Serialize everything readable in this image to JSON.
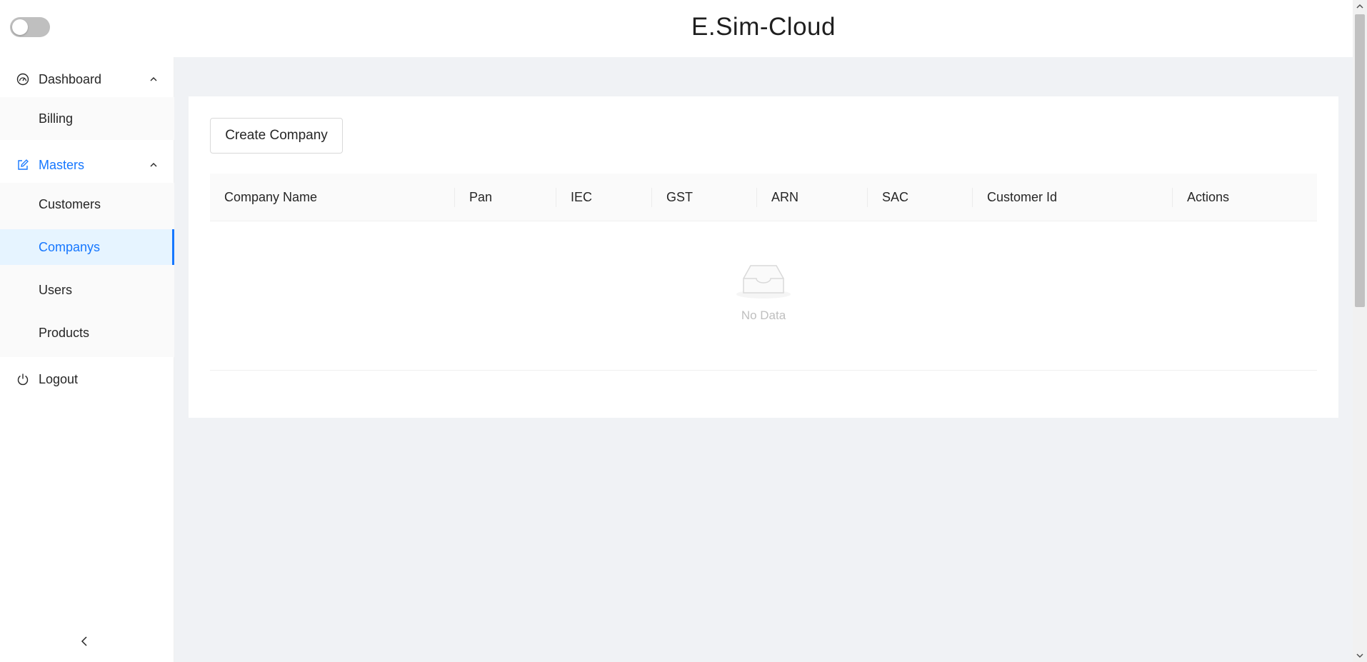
{
  "app": {
    "title": "E.Sim-Cloud",
    "theme_toggle": "off"
  },
  "colors": {
    "accent": "#1677ff",
    "active_bg": "#e6f4ff",
    "content_bg": "#f0f2f5"
  },
  "sidebar": {
    "items": [
      {
        "label": "Dashboard",
        "icon": "dashboard-icon",
        "expanded": true
      },
      {
        "label": "Billing",
        "sub": true
      },
      {
        "label": "Masters",
        "icon": "edit-icon",
        "expanded": true
      },
      {
        "label": "Customers",
        "sub": true
      },
      {
        "label": "Companys",
        "sub": true,
        "active": true
      },
      {
        "label": "Users",
        "sub": true
      },
      {
        "label": "Products",
        "sub": true
      },
      {
        "label": "Logout",
        "icon": "power-icon"
      }
    ],
    "collapse_icon": "chevron-left-icon"
  },
  "main": {
    "create_button": "Create Company",
    "table": {
      "columns": [
        "Company Name",
        "Pan",
        "IEC",
        "GST",
        "ARN",
        "SAC",
        "Customer Id",
        "Actions"
      ],
      "rows": [],
      "empty_text": "No Data",
      "empty_icon": "inbox-icon"
    }
  }
}
